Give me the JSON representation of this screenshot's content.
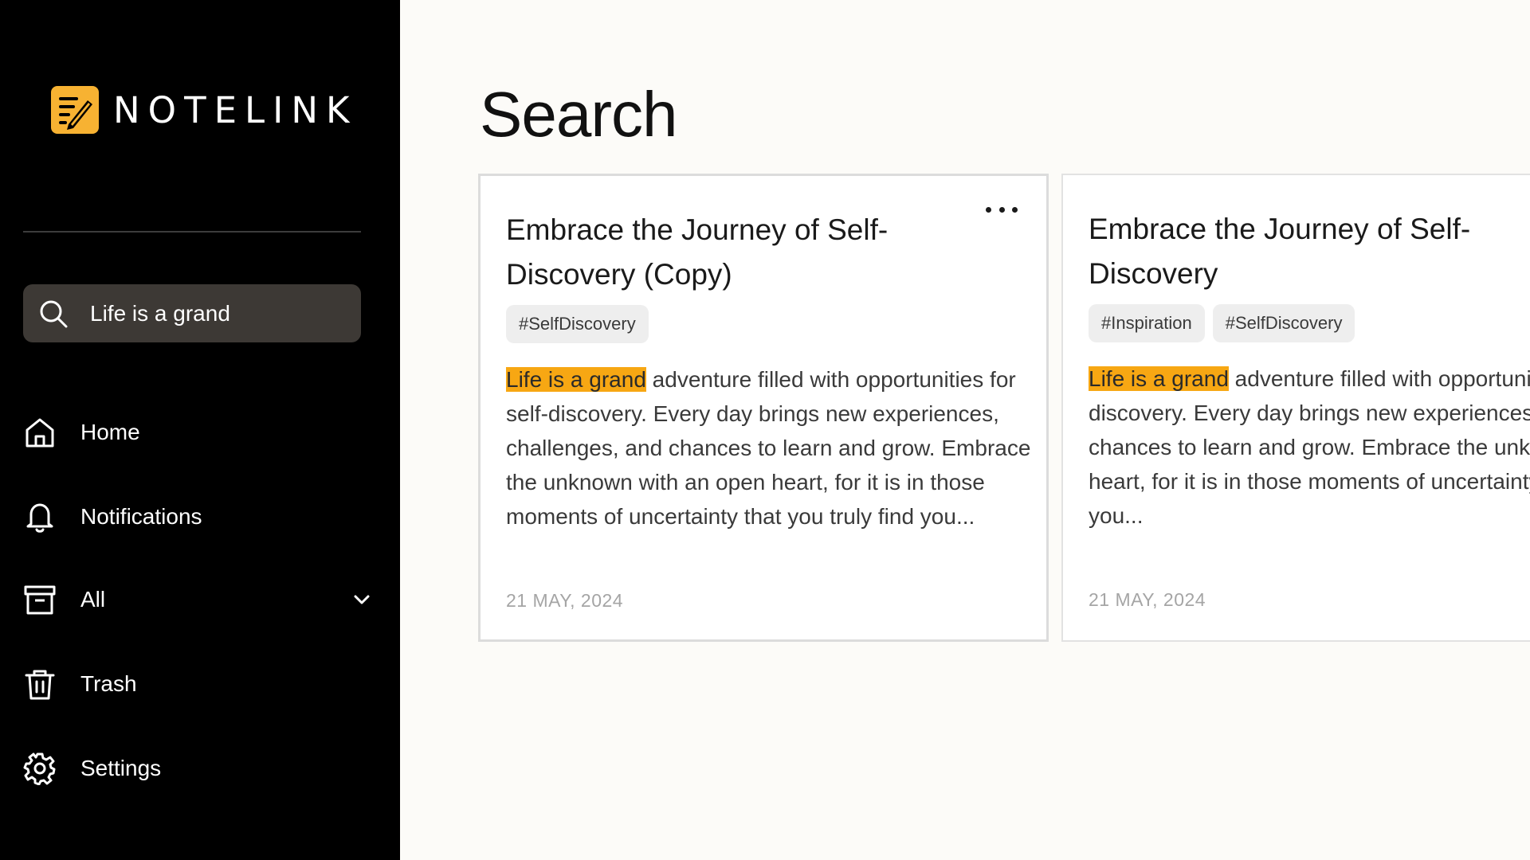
{
  "app": {
    "logo_text": "NOTELINK"
  },
  "colors": {
    "sidebar_bg": "#000000",
    "accent": "#f7a713",
    "search_bg": "#3d3935",
    "page_bg": "#fcfbf8"
  },
  "sidebar": {
    "search": {
      "value": "Life is a grand",
      "icon": "search-icon"
    },
    "items": [
      {
        "label": "Home",
        "icon": "home-icon"
      },
      {
        "label": "Notifications",
        "icon": "bell-icon"
      },
      {
        "label": "All",
        "icon": "archive-icon",
        "has_dropdown": true
      },
      {
        "label": "Trash",
        "icon": "trash-icon"
      },
      {
        "label": "Settings",
        "icon": "gear-icon"
      }
    ]
  },
  "main": {
    "title": "Search",
    "cards": [
      {
        "title": "Embrace the Journey of Self-Discovery (Copy)",
        "tags": [
          "#SelfDiscovery"
        ],
        "highlight": "Life is a grand",
        "body": " adventure filled with opportunities for self-discovery. Every day brings new experiences, challenges, and chances to learn and grow. Embrace the unknown with an open heart, for it is in those moments of uncertainty that you truly find you...",
        "date": "21 MAY, 2024",
        "has_menu": true
      },
      {
        "title": "Embrace the Journey of Self-Discovery",
        "tags": [
          "#Inspiration",
          "#SelfDiscovery"
        ],
        "highlight": "Life is a grand",
        "body": " adventure filled with opportunities for self-discovery. Every day brings new experiences, challenges, and chances to learn and grow. Embrace the unknown with an open heart, for it is in those moments of uncertainty that you truly find you...",
        "date": "21 MAY, 2024",
        "has_menu": false
      }
    ]
  }
}
